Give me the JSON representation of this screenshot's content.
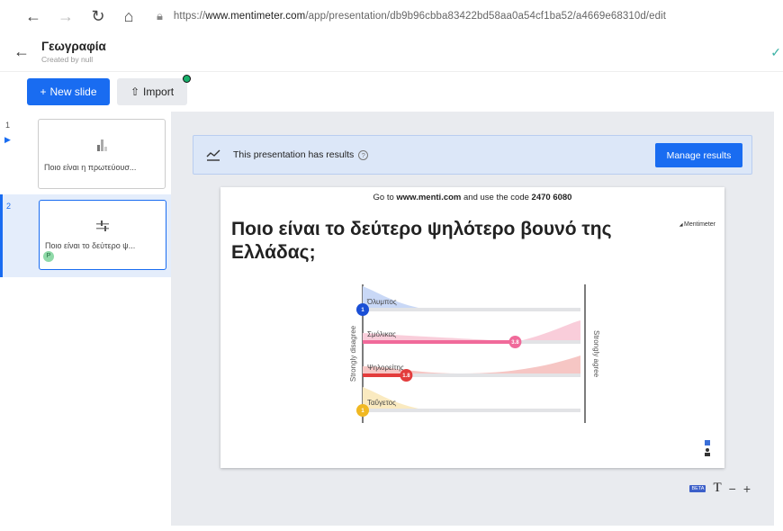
{
  "browser": {
    "url_prefix": "https://",
    "url_host": "www.mentimeter.com",
    "url_path": "/app/presentation/db9b96cbba83422bd58aa0a54cf1ba52/a4669e68310d/edit"
  },
  "header": {
    "title": "Γεωγραφία",
    "subtitle": "Created by null"
  },
  "toolbar": {
    "new_slide_label": "New slide",
    "import_label": "Import"
  },
  "slides": [
    {
      "number": "1",
      "text": "Ποιο είναι η πρωτεύουσ..."
    },
    {
      "number": "2",
      "text": "Ποιο είναι το δεύτερο ψ...",
      "badge": "P"
    }
  ],
  "banner": {
    "text": "This presentation has results",
    "help": "?",
    "manage_label": "Manage results"
  },
  "slide": {
    "goto_pre": "Go to ",
    "goto_site": "www.menti.com",
    "goto_mid": " and use the code ",
    "goto_code": "2470 6080",
    "question": "Ποιο είναι το δεύτερο ψηλότερο βουνό της Ελλάδας;",
    "brand": "Mentimeter"
  },
  "chart_data": {
    "type": "scale",
    "left_label": "Strongly disagree",
    "right_label": "Strongly agree",
    "range": [
      1,
      5
    ],
    "items": [
      {
        "label": "Όλυμπος",
        "value": 1,
        "value_label": "1",
        "color": "#1a4fd6",
        "dist_color": "#c9d8f6"
      },
      {
        "label": "Σμόλικας",
        "value": 3.8,
        "value_label": "3.8",
        "color": "#f06a9a",
        "dist_color": "#f9cdda"
      },
      {
        "label": "Ψηλορείτης",
        "value": 1.8,
        "value_label": "1.8",
        "color": "#e33c3c",
        "dist_color": "#f6c6c4"
      },
      {
        "label": "Ταΰγετος",
        "value": 1,
        "value_label": "1",
        "color": "#f0b822",
        "dist_color": "#faeac0"
      }
    ]
  },
  "footer": {
    "beta_label": "BETA",
    "text_tool": "T",
    "zoom_out": "−",
    "zoom_in": "+"
  }
}
